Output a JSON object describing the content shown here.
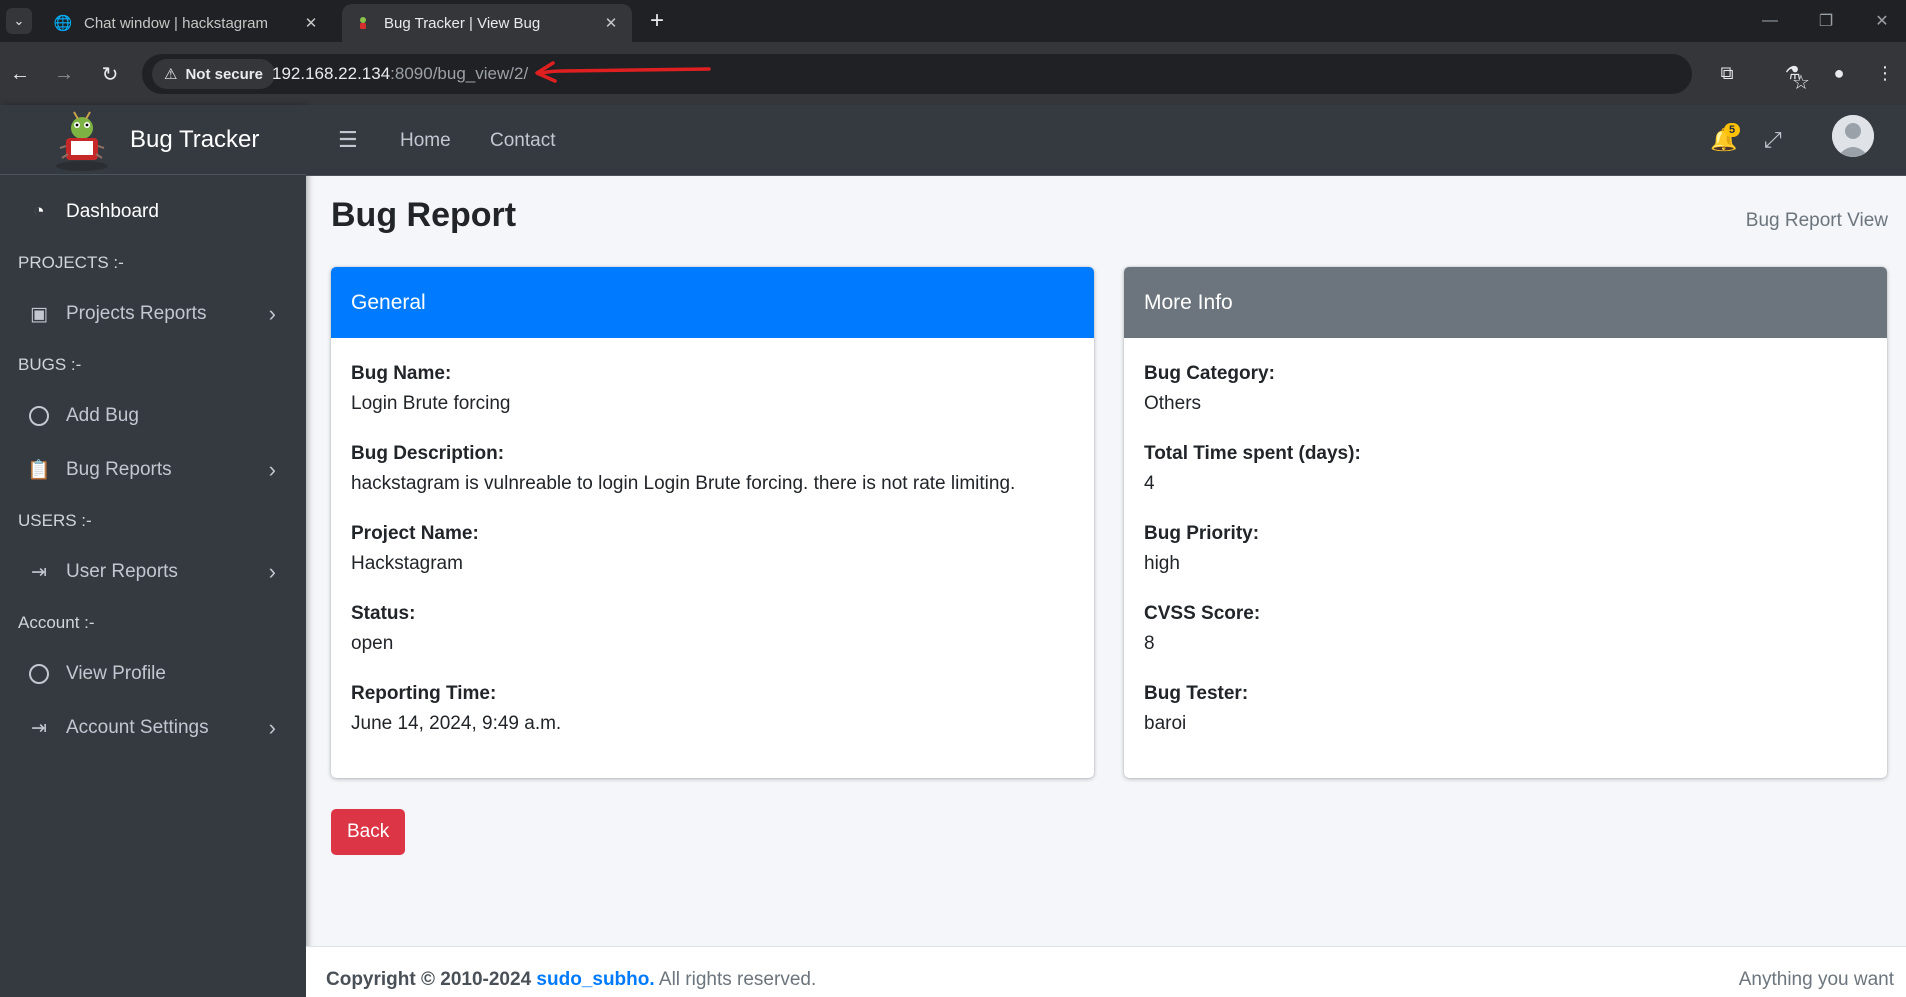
{
  "browser": {
    "tabs": [
      {
        "title": "Chat window | hackstagram",
        "icon": "globe-icon",
        "active": false
      },
      {
        "title": "Bug Tracker | View Bug",
        "icon": "bug-tracker-favicon",
        "active": true
      }
    ],
    "security_label": "Not secure",
    "url_host": "192.168.22.134",
    "url_path": ":8090/bug_view/2/",
    "annotation_arrow_color": "#e02020"
  },
  "app": {
    "brand": "Bug Tracker",
    "topnav": {
      "home": "Home",
      "contact": "Contact"
    },
    "notification_count": "5"
  },
  "sidebar": {
    "dashboard": "Dashboard",
    "sections": {
      "projects": "PROJECTS :-",
      "bugs": "BUGS :-",
      "users": "USERS :-",
      "account": "Account :-"
    },
    "items": {
      "projects_reports": "Projects Reports",
      "add_bug": "Add Bug",
      "bug_reports": "Bug Reports",
      "user_reports": "User Reports",
      "view_profile": "View Profile",
      "account_settings": "Account Settings"
    }
  },
  "page": {
    "title": "Bug Report",
    "breadcrumb": "Bug Report View",
    "back_label": "Back"
  },
  "general": {
    "header": "General",
    "fields": [
      {
        "label": "Bug Name:",
        "value": "Login Brute forcing"
      },
      {
        "label": "Bug Description:",
        "value": "hackstagram is vulnreable to login Login Brute forcing. there is not rate limiting."
      },
      {
        "label": "Project Name:",
        "value": "Hackstagram"
      },
      {
        "label": "Status:",
        "value": "open"
      },
      {
        "label": "Reporting Time:",
        "value": "June 14, 2024, 9:49 a.m."
      }
    ]
  },
  "more_info": {
    "header": "More Info",
    "fields": [
      {
        "label": "Bug Category:",
        "value": "Others"
      },
      {
        "label": "Total Time spent (days):",
        "value": "4"
      },
      {
        "label": "Bug Priority:",
        "value": "high"
      },
      {
        "label": "CVSS Score:",
        "value": "8"
      },
      {
        "label": "Bug Tester:",
        "value": "baroi"
      }
    ]
  },
  "footer": {
    "copyright": "Copyright © 2010-2024",
    "author": "sudo_subho.",
    "rights": "All rights reserved.",
    "right_text": "Anything you want"
  },
  "colors": {
    "primary": "#007bff",
    "secondary": "#6c757d",
    "danger": "#dc3545",
    "sidebar_bg": "#343a40",
    "badge": "#ffc107"
  }
}
